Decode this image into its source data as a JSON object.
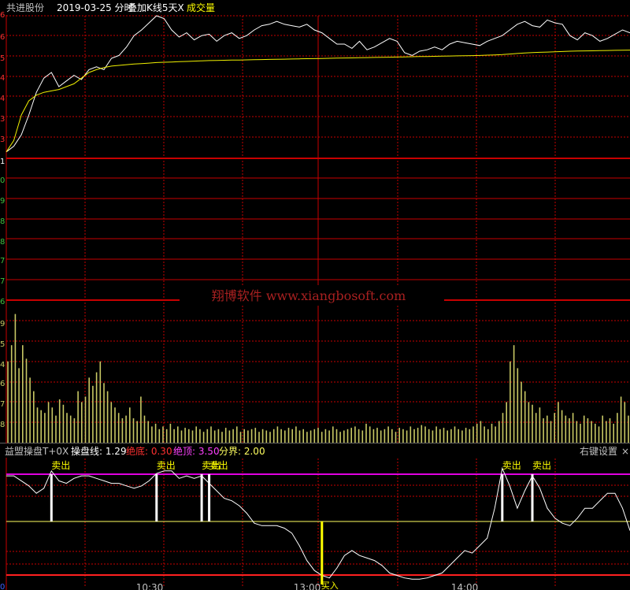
{
  "header": {
    "stock_name": "共进股份",
    "date_mode": "2019-03-25 分时",
    "overlay": "叠加K线5天X",
    "volume_label": "成交量"
  },
  "watermark": "翔博软件 www.xiangbosoft.com",
  "indicator": {
    "name": "益盟操盘T+0X",
    "line_label": "操盘线: 1.29",
    "bottom_label": "绝底: 0.30",
    "top_label": "绝顶: 3.50",
    "divide_label": "分界: 2.00",
    "settings": "右键设置",
    "close_symbol": "×",
    "sell_label": "卖出",
    "buy_label": "买入"
  },
  "axis": {
    "time_ticks": [
      "10:30",
      "13:00",
      "14:00"
    ],
    "price_left_ticks": [
      "6",
      "6",
      "5",
      "4",
      "4",
      "3",
      "3",
      "1",
      "0",
      "9",
      "8",
      "8",
      "7",
      "7",
      "6",
      "2"
    ],
    "volume_left_ticks": [
      "9",
      "5",
      "4",
      "6",
      "7",
      "8",
      "9"
    ],
    "indicator_left_ticks": [
      "0"
    ]
  },
  "colors": {
    "price_line": "#ffffff",
    "avg_line": "#f0f000",
    "grid": "#c80000",
    "volume": "#c8c864",
    "top_line": "#e000e0",
    "divide_line": "#ffff60",
    "bottom_line": "#ff2020",
    "sell_text": "#ffff00",
    "header_yellow": "#ffff00"
  },
  "chart_data": [
    {
      "type": "line",
      "series": [
        {
          "values": [
            0.04,
            0.08,
            0.16,
            0.3,
            0.46,
            0.56,
            0.6,
            0.5,
            0.54,
            0.58,
            0.55,
            0.62,
            0.64,
            0.62,
            0.7,
            0.72,
            0.78,
            0.86,
            0.9,
            0.95,
            1.0,
            0.98,
            0.9,
            0.85,
            0.88,
            0.83,
            0.86,
            0.87,
            0.82,
            0.86,
            0.88,
            0.84,
            0.86,
            0.9,
            0.93,
            0.94,
            0.96,
            0.94,
            0.93,
            0.92,
            0.94,
            0.9,
            0.88,
            0.84,
            0.8,
            0.8,
            0.77,
            0.82,
            0.76,
            0.78,
            0.81,
            0.84,
            0.82,
            0.74,
            0.72,
            0.75,
            0.76,
            0.78,
            0.76,
            0.8,
            0.82,
            0.81,
            0.8,
            0.79,
            0.82,
            0.84,
            0.86,
            0.9,
            0.94,
            0.96,
            0.93,
            0.92,
            0.97,
            0.95,
            0.94,
            0.86,
            0.83,
            0.88,
            0.86,
            0.82,
            0.84,
            0.87,
            0.9,
            0.88
          ],
          "color": "#ffffff"
        },
        {
          "values": [
            0.04,
            0.12,
            0.3,
            0.4,
            0.44,
            0.46,
            0.47,
            0.48,
            0.5,
            0.52,
            0.56,
            0.6,
            0.62,
            0.635,
            0.645,
            0.65,
            0.655,
            0.66,
            0.663,
            0.666,
            0.67,
            0.672,
            0.674,
            0.676,
            0.678,
            0.68,
            0.682,
            0.684,
            0.685,
            0.686,
            0.687,
            0.688,
            0.689,
            0.69,
            0.691,
            0.692,
            0.693,
            0.694,
            0.695,
            0.696,
            0.697,
            0.698,
            0.699,
            0.7,
            0.701,
            0.702,
            0.703,
            0.704,
            0.705,
            0.706,
            0.707,
            0.708,
            0.709,
            0.71,
            0.711,
            0.712,
            0.713,
            0.714,
            0.715,
            0.716,
            0.717,
            0.718,
            0.719,
            0.72,
            0.722,
            0.724,
            0.726,
            0.73,
            0.734,
            0.738,
            0.74,
            0.742,
            0.744,
            0.746,
            0.748,
            0.75,
            0.751,
            0.752,
            0.753,
            0.754,
            0.755,
            0.756,
            0.757,
            0.758
          ],
          "color": "#f0f000"
        }
      ]
    },
    {
      "type": "bar",
      "values": [
        0.6,
        0.72,
        0.95,
        0.55,
        0.72,
        0.62,
        0.48,
        0.38,
        0.26,
        0.24,
        0.22,
        0.3,
        0.26,
        0.2,
        0.32,
        0.28,
        0.22,
        0.2,
        0.18,
        0.38,
        0.3,
        0.34,
        0.48,
        0.42,
        0.52,
        0.6,
        0.44,
        0.38,
        0.3,
        0.26,
        0.22,
        0.18,
        0.2,
        0.26,
        0.18,
        0.16,
        0.34,
        0.2,
        0.16,
        0.12,
        0.14,
        0.1,
        0.12,
        0.1,
        0.14,
        0.1,
        0.12,
        0.09,
        0.11,
        0.1,
        0.09,
        0.12,
        0.1,
        0.08,
        0.1,
        0.12,
        0.09,
        0.1,
        0.08,
        0.11,
        0.09,
        0.1,
        0.12,
        0.08,
        0.1,
        0.09,
        0.1,
        0.11,
        0.08,
        0.1,
        0.09,
        0.08,
        0.1,
        0.12,
        0.1,
        0.09,
        0.11,
        0.1,
        0.12,
        0.09,
        0.1,
        0.08,
        0.09,
        0.1,
        0.11,
        0.08,
        0.1,
        0.09,
        0.12,
        0.1,
        0.08,
        0.09,
        0.1,
        0.11,
        0.12,
        0.1,
        0.09,
        0.14,
        0.12,
        0.1,
        0.11,
        0.09,
        0.1,
        0.12,
        0.1,
        0.08,
        0.11,
        0.1,
        0.09,
        0.12,
        0.1,
        0.11,
        0.13,
        0.12,
        0.1,
        0.09,
        0.12,
        0.1,
        0.11,
        0.09,
        0.1,
        0.12,
        0.1,
        0.09,
        0.11,
        0.1,
        0.12,
        0.14,
        0.16,
        0.12,
        0.1,
        0.14,
        0.12,
        0.16,
        0.22,
        0.3,
        0.6,
        0.72,
        0.55,
        0.45,
        0.38,
        0.3,
        0.28,
        0.22,
        0.26,
        0.18,
        0.2,
        0.16,
        0.22,
        0.3,
        0.24,
        0.2,
        0.18,
        0.22,
        0.16,
        0.14,
        0.2,
        0.18,
        0.16,
        0.14,
        0.12,
        0.2,
        0.16,
        0.18,
        0.14,
        0.22,
        0.34,
        0.3,
        0.2
      ],
      "color": "#c8c864"
    },
    {
      "type": "line",
      "series": [
        {
          "values": [
            0.86,
            0.86,
            0.82,
            0.78,
            0.72,
            0.76,
            0.9,
            0.82,
            0.8,
            0.84,
            0.86,
            0.86,
            0.84,
            0.82,
            0.8,
            0.8,
            0.78,
            0.76,
            0.78,
            0.82,
            0.88,
            0.9,
            0.9,
            0.84,
            0.86,
            0.84,
            0.86,
            0.8,
            0.74,
            0.68,
            0.66,
            0.62,
            0.56,
            0.48,
            0.46,
            0.46,
            0.46,
            0.44,
            0.4,
            0.3,
            0.18,
            0.1,
            0.06,
            0.04,
            0.12,
            0.22,
            0.26,
            0.22,
            0.2,
            0.18,
            0.14,
            0.08,
            0.06,
            0.04,
            0.03,
            0.03,
            0.04,
            0.06,
            0.08,
            0.14,
            0.2,
            0.26,
            0.24,
            0.3,
            0.36,
            0.6,
            0.92,
            0.78,
            0.6,
            0.74,
            0.86,
            0.76,
            0.6,
            0.52,
            0.48,
            0.46,
            0.52,
            0.6,
            0.6,
            0.66,
            0.72,
            0.72,
            0.6,
            0.42
          ],
          "color": "#ffffff"
        }
      ],
      "levels": {
        "top": 3.5,
        "divide": 2.0,
        "bottom": 0.3
      },
      "sell_points": [
        6,
        20,
        26,
        27,
        66,
        70
      ],
      "buy_points": [
        42
      ]
    }
  ]
}
